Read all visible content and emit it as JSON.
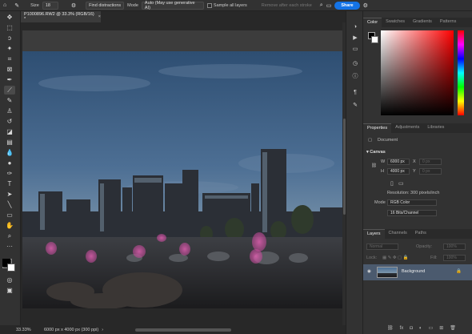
{
  "options_bar": {
    "size_label": "Size",
    "size_value": "18",
    "find_distractions": "Find distractions",
    "mode_label": "Mode",
    "mode_value": "Auto (May use generative AI)",
    "sample_all_layers": "Sample all layers",
    "remove_after_stroke": "Remove after each stroke",
    "share": "Share"
  },
  "document_tab": {
    "title": "P1000896.RW2 @ 33.3% (RGB/16) *"
  },
  "status_bar": {
    "zoom": "33.33%",
    "doc_info": "6000 px x 4000 px (300 ppi)"
  },
  "color_panel": {
    "tabs": [
      "Color",
      "Swatches",
      "Gradients",
      "Patterns"
    ]
  },
  "properties_panel": {
    "tabs": [
      "Properties",
      "Adjustments",
      "Libraries"
    ],
    "document_label": "Document",
    "canvas_heading": "Canvas",
    "w_label": "W",
    "w_value": "6000 px",
    "h_label": "H",
    "h_value": "4000 px",
    "x_label": "X",
    "x_value": "0 px",
    "y_label": "Y",
    "y_value": "0 px",
    "resolution": "Resolution: 300 pixels/inch",
    "mode_label": "Mode",
    "mode_value": "RGB Color",
    "bit_depth": "16 Bits/Channel"
  },
  "layers_panel": {
    "tabs": [
      "Layers",
      "Channels",
      "Paths"
    ],
    "kind_filter": "Normal",
    "opacity_label": "Opacity:",
    "opacity_value": "100%",
    "lock_label": "Lock:",
    "fill_label": "Fill:",
    "fill_value": "100%",
    "layers": [
      {
        "name": "Background"
      }
    ]
  },
  "colors": {
    "accent": "#1473e6",
    "brush_mark": "#d64fa0",
    "foreground": "#000000",
    "background": "#ffffff"
  }
}
